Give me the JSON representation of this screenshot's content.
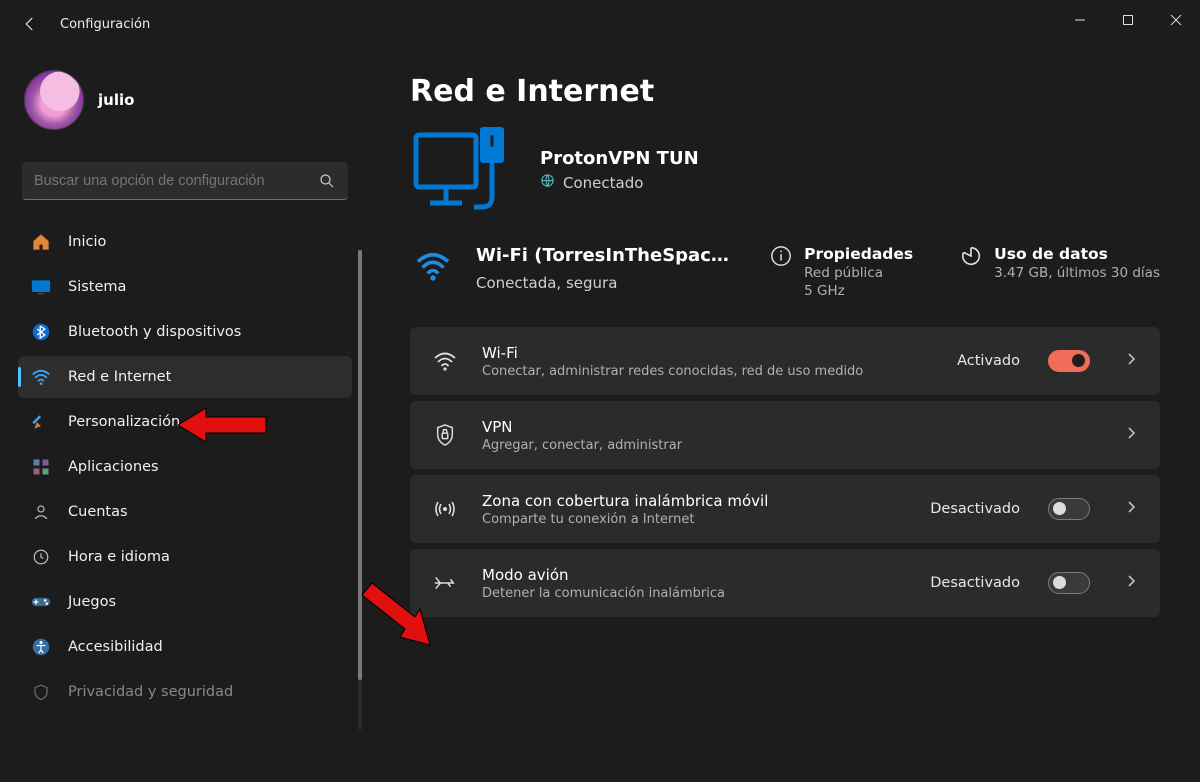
{
  "window": {
    "title": "Configuración"
  },
  "user": {
    "name": "julio"
  },
  "search": {
    "placeholder": "Buscar una opción de configuración"
  },
  "nav": {
    "items": [
      {
        "id": "home",
        "label": "Inicio"
      },
      {
        "id": "system",
        "label": "Sistema"
      },
      {
        "id": "bluetooth",
        "label": "Bluetooth y dispositivos"
      },
      {
        "id": "network",
        "label": "Red e Internet"
      },
      {
        "id": "personalization",
        "label": "Personalización"
      },
      {
        "id": "apps",
        "label": "Aplicaciones"
      },
      {
        "id": "accounts",
        "label": "Cuentas"
      },
      {
        "id": "time",
        "label": "Hora e idioma"
      },
      {
        "id": "gaming",
        "label": "Juegos"
      },
      {
        "id": "accessibility",
        "label": "Accesibilidad"
      },
      {
        "id": "privacy",
        "label": "Privacidad y seguridad"
      }
    ],
    "selected": "network"
  },
  "page": {
    "title": "Red e Internet",
    "connection": {
      "name": "ProtonVPN TUN",
      "status": "Conectado"
    },
    "wifi": {
      "name": "Wi-Fi (TorresInTheSpac…",
      "sub": "Conectada, segura",
      "properties": {
        "label": "Propiedades",
        "sub1": "Red pública",
        "sub2": "5 GHz"
      },
      "usage": {
        "label": "Uso de datos",
        "sub": "3.47 GB, últimos 30 días"
      }
    },
    "cards": [
      {
        "id": "wifi",
        "title": "Wi-Fi",
        "sub": "Conectar, administrar redes conocidas, red de uso medido",
        "state": "Activado",
        "toggle": true,
        "on": true
      },
      {
        "id": "vpn",
        "title": "VPN",
        "sub": "Agregar, conectar, administrar"
      },
      {
        "id": "hotspot",
        "title": "Zona con cobertura inalámbrica móvil",
        "sub": "Comparte tu conexión a Internet",
        "state": "Desactivado",
        "toggle": true,
        "on": false
      },
      {
        "id": "airplane",
        "title": "Modo avión",
        "sub": "Detener la comunicación inalámbrica",
        "state": "Desactivado",
        "toggle": true,
        "on": false
      }
    ]
  }
}
